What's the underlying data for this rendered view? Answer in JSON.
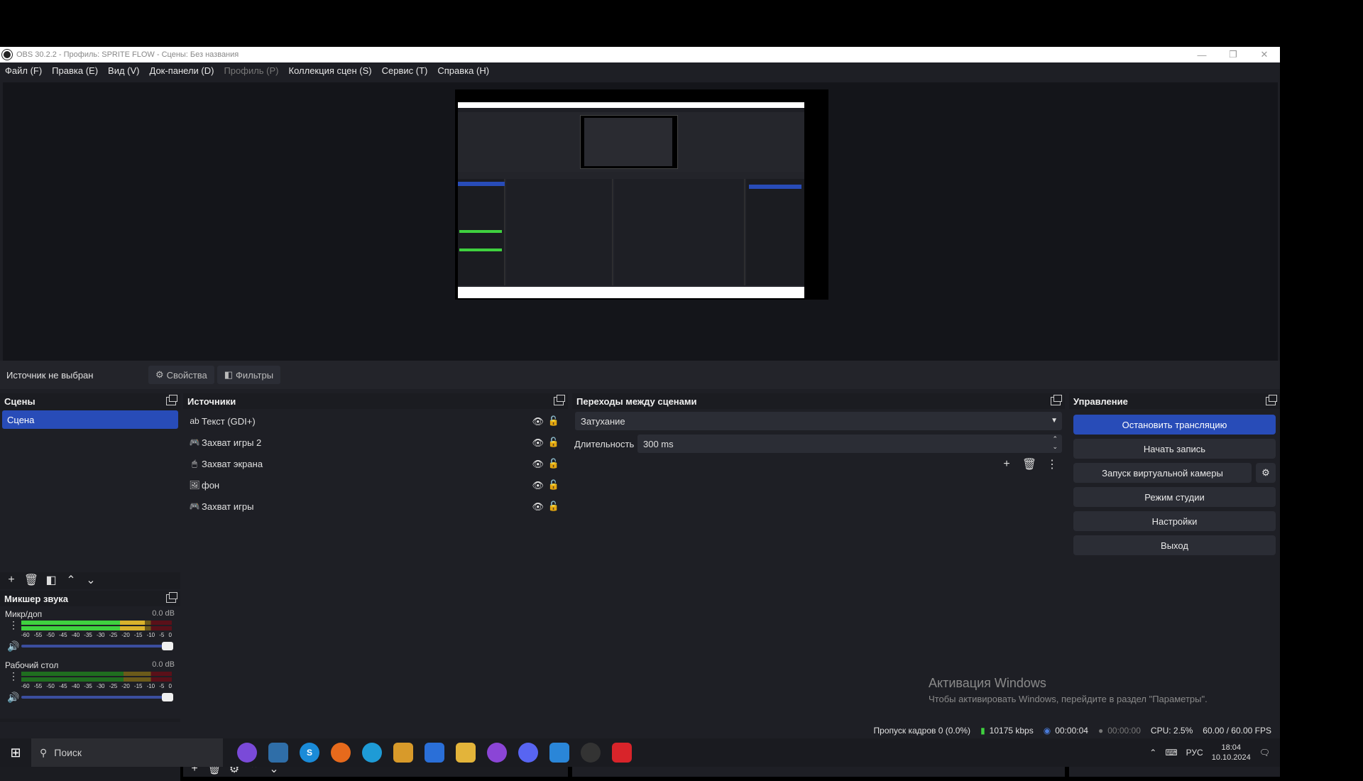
{
  "window": {
    "title": "OBS 30.2.2 - Профиль: SPRITE FLOW - Сцены: Без названия"
  },
  "menu": [
    {
      "label": "Файл (F)",
      "disabled": false
    },
    {
      "label": "Правка (E)",
      "disabled": false
    },
    {
      "label": "Вид (V)",
      "disabled": false
    },
    {
      "label": "Док-панели (D)",
      "disabled": false
    },
    {
      "label": "Профиль (P)",
      "disabled": true
    },
    {
      "label": "Коллекция сцен (S)",
      "disabled": false
    },
    {
      "label": "Сервис (T)",
      "disabled": false
    },
    {
      "label": "Справка (H)",
      "disabled": false
    }
  ],
  "infobar": {
    "no_source": "Источник не выбран",
    "properties": "Свойства",
    "filters": "Фильтры"
  },
  "scenes": {
    "title": "Сцены",
    "items": [
      "Сцена"
    ],
    "selected": 0
  },
  "sources": {
    "title": "Источники",
    "items": [
      {
        "label": "Текст (GDI+)",
        "icon": "text-icon"
      },
      {
        "label": "Захват игры 2",
        "icon": "gamepad-icon"
      },
      {
        "label": "Захват экрана",
        "icon": "monitor-icon"
      },
      {
        "label": "фон",
        "icon": "image-icon"
      },
      {
        "label": "Захват игры",
        "icon": "gamepad-icon"
      }
    ]
  },
  "transitions": {
    "title": "Переходы между сценами",
    "selected": "Затухание",
    "duration_label": "Длительность",
    "duration_value": "300 ms"
  },
  "controls": {
    "title": "Управление",
    "stop_stream": "Остановить трансляцию",
    "start_record": "Начать запись",
    "virtual_cam": "Запуск виртуальной камеры",
    "studio_mode": "Режим студии",
    "settings": "Настройки",
    "exit": "Выход"
  },
  "mixer": {
    "title": "Микшер звука",
    "channels": [
      {
        "name": "Микр/доп",
        "db": "0.0 dB",
        "level": 0.82
      },
      {
        "name": "Рабочий стол",
        "db": "0.0 dB",
        "level": 0.0
      }
    ],
    "scale": [
      "-60",
      "-55",
      "-50",
      "-45",
      "-40",
      "-35",
      "-30",
      "-25",
      "-20",
      "-15",
      "-10",
      "-5",
      "0"
    ]
  },
  "status": {
    "dropped_frames": "Пропуск кадров 0 (0.0%)",
    "bitrate": "10175 kbps",
    "stream_time": "00:00:04",
    "record_time": "00:00:00",
    "cpu": "CPU: 2.5%",
    "fps": "60.00 / 60.00 FPS"
  },
  "watermark": {
    "title": "Активация Windows",
    "subtitle": "Чтобы активировать Windows, перейдите в раздел \"Параметры\"."
  },
  "taskbar": {
    "search": "Поиск",
    "lang": "РУС",
    "time": "18:04",
    "date": "10.10.2024"
  },
  "colors": {
    "accent": "#284cb8",
    "bg": "#1e1f25",
    "meter_green": "#3fd13f",
    "meter_yellow": "#d8b22c",
    "meter_red": "#b32030"
  }
}
